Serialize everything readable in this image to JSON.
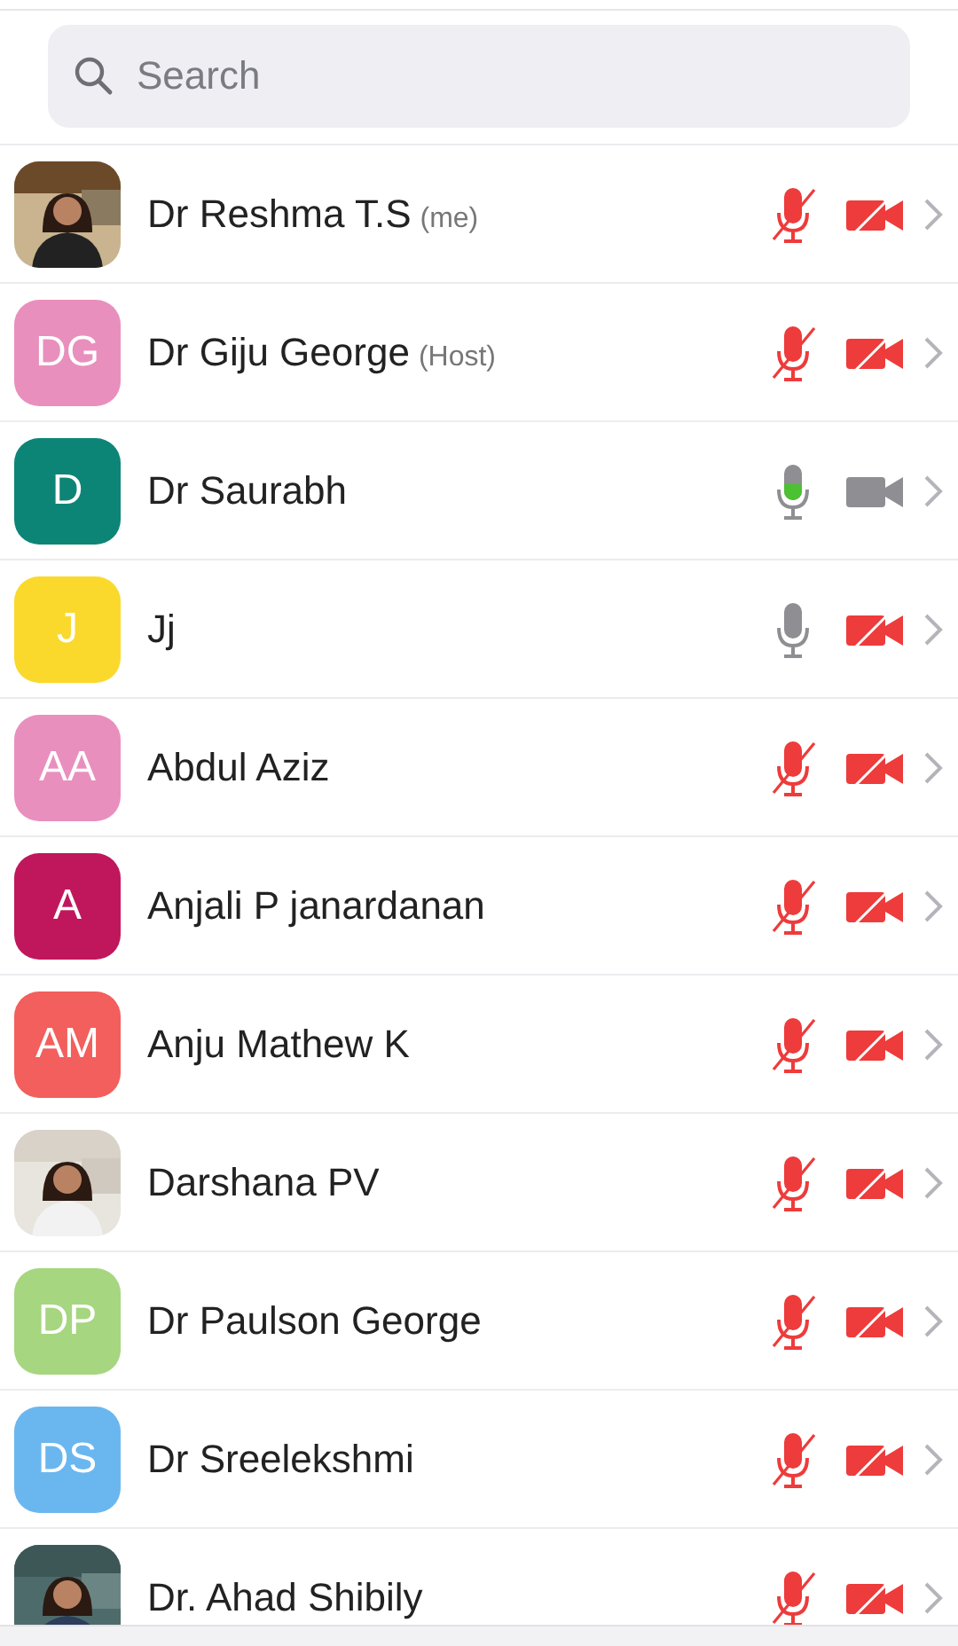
{
  "search": {
    "placeholder": "Search"
  },
  "participants": [
    {
      "name": "Dr Reshma T.S",
      "tag": "(me)",
      "muted": true,
      "speaking": false,
      "camera_on": false
    },
    {
      "name": "Dr Giju George",
      "tag": "(Host)",
      "avatar": {
        "kind": "initials",
        "initials": "DG",
        "color": "#e98fbd"
      },
      "muted": true,
      "speaking": false,
      "camera_on": false
    },
    {
      "name": "Dr Saurabh",
      "avatar": {
        "kind": "initials",
        "initials": "D",
        "color": "#0d8576"
      },
      "muted": false,
      "speaking": true,
      "camera_on": true
    },
    {
      "name": "Jj",
      "avatar": {
        "kind": "initials",
        "initials": "J",
        "color": "#fad92c"
      },
      "muted": false,
      "speaking": false,
      "camera_on": false
    },
    {
      "name": "Abdul Aziz",
      "avatar": {
        "kind": "initials",
        "initials": "AA",
        "color": "#e98fbe"
      },
      "muted": true,
      "speaking": false,
      "camera_on": false
    },
    {
      "name": "Anjali P janardanan",
      "avatar": {
        "kind": "initials",
        "initials": "A",
        "color": "#c0175c"
      },
      "muted": true,
      "speaking": false,
      "camera_on": false
    },
    {
      "name": "Anju Mathew K",
      "avatar": {
        "kind": "initials",
        "initials": "AM",
        "color": "#f25f5c"
      },
      "muted": true,
      "speaking": false,
      "camera_on": false
    },
    {
      "name": "Darshana PV",
      "muted": true,
      "speaking": false,
      "camera_on": false
    },
    {
      "name": "Dr Paulson George",
      "avatar": {
        "kind": "initials",
        "initials": "DP",
        "color": "#a6d680"
      },
      "muted": true,
      "speaking": false,
      "camera_on": false
    },
    {
      "name": "Dr Sreelekshmi",
      "avatar": {
        "kind": "initials",
        "initials": "DS",
        "color": "#6ab7f0"
      },
      "muted": true,
      "speaking": false,
      "camera_on": false
    },
    {
      "name": "Dr. Ahad Shibily",
      "muted": true,
      "speaking": false,
      "camera_on": false
    }
  ]
}
